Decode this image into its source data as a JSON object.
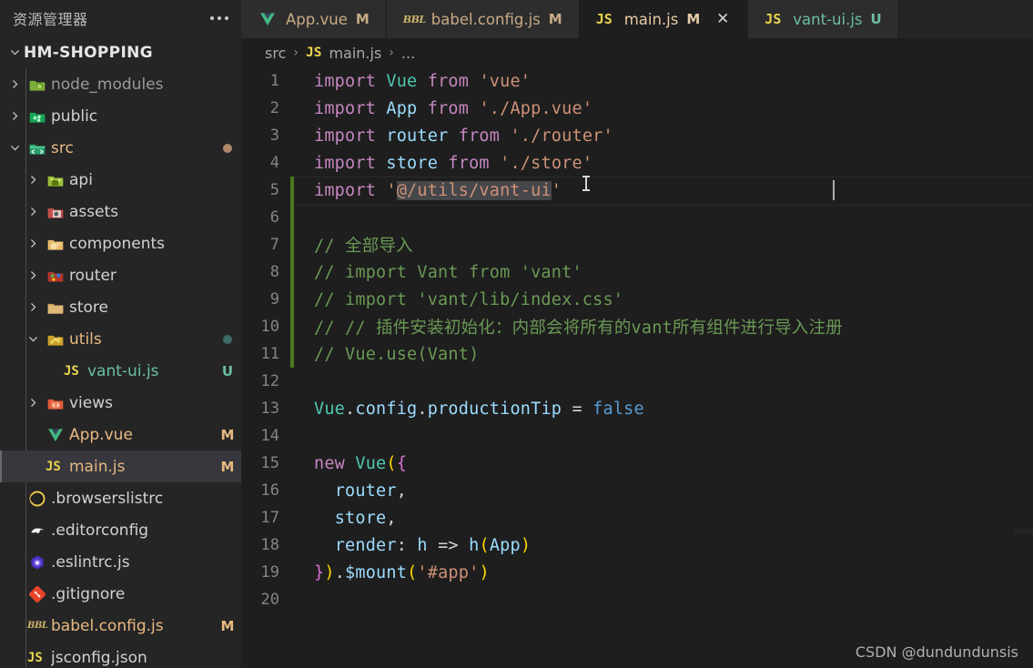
{
  "sidebar": {
    "title": "资源管理器",
    "more_label": "···",
    "root": {
      "label": "HM-SHOPPING",
      "expanded": true
    },
    "items": [
      {
        "label": "node_modules",
        "icon": "folder-node-modules-icon",
        "type": "folder",
        "expanded": false,
        "indent": 1,
        "badge": "",
        "dot": ""
      },
      {
        "label": "public",
        "icon": "folder-public-icon",
        "type": "folder",
        "expanded": false,
        "indent": 1,
        "badge": "",
        "dot": ""
      },
      {
        "label": "src",
        "icon": "folder-src-icon",
        "type": "folder",
        "expanded": true,
        "indent": 1,
        "badge": "",
        "dot": "#b0876a"
      },
      {
        "label": "api",
        "icon": "folder-api-icon",
        "type": "folder",
        "expanded": false,
        "indent": 2,
        "badge": "",
        "dot": ""
      },
      {
        "label": "assets",
        "icon": "folder-assets-icon",
        "type": "folder",
        "expanded": false,
        "indent": 2,
        "badge": "",
        "dot": ""
      },
      {
        "label": "components",
        "icon": "folder-components-icon",
        "type": "folder",
        "expanded": false,
        "indent": 2,
        "badge": "",
        "dot": ""
      },
      {
        "label": "router",
        "icon": "folder-router-icon",
        "type": "folder",
        "expanded": false,
        "indent": 2,
        "badge": "",
        "dot": ""
      },
      {
        "label": "store",
        "icon": "folder-store-icon",
        "type": "folder",
        "expanded": false,
        "indent": 2,
        "badge": "",
        "dot": ""
      },
      {
        "label": "utils",
        "icon": "folder-utils-icon",
        "type": "folder",
        "expanded": true,
        "indent": 2,
        "badge": "",
        "dot": "#3d6c66"
      },
      {
        "label": "vant-ui.js",
        "icon": "js-file-icon",
        "type": "file",
        "expanded": null,
        "indent": 3,
        "badge": "U",
        "dot": ""
      },
      {
        "label": "views",
        "icon": "folder-views-icon",
        "type": "folder",
        "expanded": false,
        "indent": 2,
        "badge": "",
        "dot": ""
      },
      {
        "label": "App.vue",
        "icon": "vue-file-icon",
        "type": "file",
        "expanded": null,
        "indent": 2,
        "badge": "M",
        "dot": ""
      },
      {
        "label": "main.js",
        "icon": "js-file-icon",
        "type": "file",
        "expanded": null,
        "indent": 2,
        "badge": "M",
        "dot": "",
        "selected": true
      },
      {
        "label": ".browserslistrc",
        "icon": "browserslist-file-icon",
        "type": "file",
        "expanded": null,
        "indent": 1,
        "badge": "",
        "dot": ""
      },
      {
        "label": ".editorconfig",
        "icon": "editorconfig-file-icon",
        "type": "file",
        "expanded": null,
        "indent": 1,
        "badge": "",
        "dot": ""
      },
      {
        "label": ".eslintrc.js",
        "icon": "eslint-file-icon",
        "type": "file",
        "expanded": null,
        "indent": 1,
        "badge": "",
        "dot": ""
      },
      {
        "label": ".gitignore",
        "icon": "git-file-icon",
        "type": "file",
        "expanded": null,
        "indent": 1,
        "badge": "",
        "dot": ""
      },
      {
        "label": "babel.config.js",
        "icon": "babel-file-icon",
        "type": "file",
        "expanded": null,
        "indent": 1,
        "badge": "M",
        "dot": ""
      },
      {
        "label": "jsconfig.json",
        "icon": "js-file-icon",
        "type": "file",
        "expanded": null,
        "indent": 1,
        "badge": "",
        "dot": ""
      }
    ]
  },
  "tabs": [
    {
      "name": "App.vue",
      "icon": "vue-file-icon",
      "dirty": "M",
      "active": false,
      "closable": false
    },
    {
      "name": "babel.config.js",
      "icon": "babel-file-icon",
      "dirty": "M",
      "active": false,
      "closable": false
    },
    {
      "name": "main.js",
      "icon": "js-file-icon",
      "dirty": "M",
      "active": true,
      "closable": true,
      "close_label": "✕"
    },
    {
      "name": "vant-ui.js",
      "icon": "js-file-icon",
      "dirty": "U",
      "active": false,
      "closable": false
    }
  ],
  "breadcrumb": {
    "items": [
      "src",
      "main.js",
      "..."
    ],
    "file_icon": "js-file-icon",
    "separator": "›"
  },
  "code": {
    "language": "javascript",
    "lines": [
      {
        "n": 1,
        "modified": false,
        "text": "import Vue from 'vue'"
      },
      {
        "n": 2,
        "modified": false,
        "text": "import App from './App.vue'"
      },
      {
        "n": 3,
        "modified": false,
        "text": "import router from './router'"
      },
      {
        "n": 4,
        "modified": false,
        "text": "import store from './store'"
      },
      {
        "n": 5,
        "modified": true,
        "text": "import '@/utils/vant-ui'"
      },
      {
        "n": 6,
        "modified": true,
        "text": ""
      },
      {
        "n": 7,
        "modified": true,
        "text": "// 全部导入"
      },
      {
        "n": 8,
        "modified": true,
        "text": "// import Vant from 'vant'"
      },
      {
        "n": 9,
        "modified": true,
        "text": "// import 'vant/lib/index.css'"
      },
      {
        "n": 10,
        "modified": true,
        "text": "// // 插件安装初始化：内部会将所有的vant所有组件进行导入注册"
      },
      {
        "n": 11,
        "modified": true,
        "text": "// Vue.use(Vant)"
      },
      {
        "n": 12,
        "modified": false,
        "text": ""
      },
      {
        "n": 13,
        "modified": false,
        "text": "Vue.config.productionTip = false"
      },
      {
        "n": 14,
        "modified": false,
        "text": ""
      },
      {
        "n": 15,
        "modified": false,
        "text": "new Vue({"
      },
      {
        "n": 16,
        "modified": false,
        "text": "  router,"
      },
      {
        "n": 17,
        "modified": false,
        "text": "  store,"
      },
      {
        "n": 18,
        "modified": false,
        "text": "  render: h => h(App)"
      },
      {
        "n": 19,
        "modified": false,
        "text": "}).$mount('#app')"
      },
      {
        "n": 20,
        "modified": false,
        "text": ""
      }
    ],
    "selection": {
      "line": 5,
      "text": "@/utils/vant-ui"
    }
  },
  "watermark": "CSDN @dundundunsis",
  "colors": {
    "editor_bg": "#1e1e1e",
    "sidebar_bg": "#252526",
    "tabbar_bg": "#252526",
    "active_tab_bg": "#1e1e1e",
    "selection_bg": "#46474a",
    "modified_gutter": "#4b7a1e",
    "accent_string": "#ce9178",
    "accent_keyword": "#c586c0",
    "accent_comment": "#6a9955"
  }
}
